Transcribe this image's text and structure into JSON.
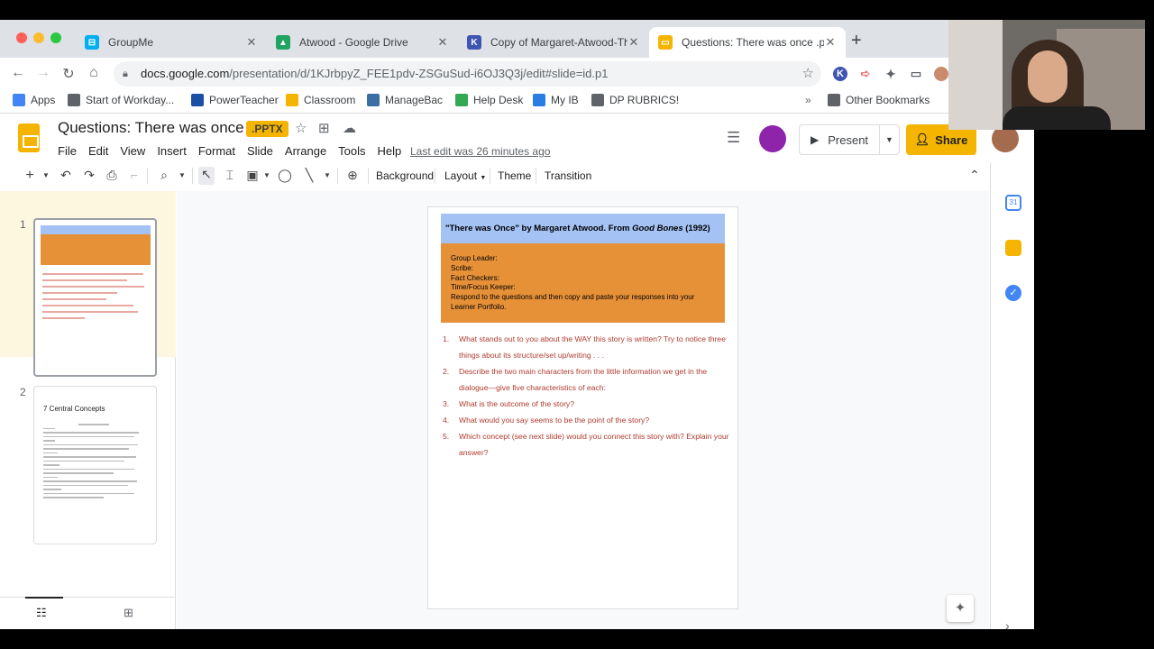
{
  "browser": {
    "tabs": [
      {
        "title": "GroupMe",
        "icon": "groupme-icon",
        "color": "#00aff0",
        "glyph": "⊟"
      },
      {
        "title": "Atwood - Google Drive",
        "icon": "google-drive-icon",
        "color": "#1fa463",
        "glyph": "▲"
      },
      {
        "title": "Copy of Margaret-Atwood-The",
        "icon": "k-icon",
        "color": "#4054b2",
        "glyph": "K"
      },
      {
        "title": "Questions: There was once .pp",
        "icon": "slides-icon",
        "color": "#f4b400",
        "glyph": "▭"
      }
    ],
    "new_tab": "+",
    "close": "✕",
    "url_host": "docs.google.com",
    "url_path": "/presentation/d/1KJrbpyZ_FEE1pdv-ZSGuSud-i6OJ3Q3j/edit#slide=id.p1"
  },
  "bookmarks": {
    "items": [
      {
        "label": "Apps",
        "color": "#4285f4"
      },
      {
        "label": "Start of Workday...",
        "color": "#5f6368"
      },
      {
        "label": "PowerTeacher",
        "color": "#1a4fa3"
      },
      {
        "label": "Classroom",
        "color": "#f4b400"
      },
      {
        "label": "ManageBac",
        "color": "#3a6ea5"
      },
      {
        "label": "Help Desk",
        "color": "#34a853"
      },
      {
        "label": "My IB",
        "color": "#2a7de1"
      },
      {
        "label": "DP RUBRICS!",
        "color": "#5f6368"
      }
    ],
    "more": "»",
    "other": "Other Bookmarks"
  },
  "doc": {
    "title": "Questions: There was once",
    "badge": ".PPTX",
    "menu": [
      "File",
      "Edit",
      "View",
      "Insert",
      "Format",
      "Slide",
      "Arrange",
      "Tools",
      "Help"
    ],
    "last_edit": "Last edit was 26 minutes ago",
    "present_label": "Present",
    "share_label": "Share"
  },
  "toolbar": {
    "background": "Background",
    "layout": "Layout",
    "theme": "Theme",
    "transition": "Transition"
  },
  "filmstrip": {
    "slides": [
      {
        "number": "1",
        "thumb_title": "\"There was Once\" by Margaret Atwood. From Good Bones (1992)"
      },
      {
        "number": "2",
        "thumb_title": "7 Central Concepts"
      }
    ]
  },
  "slide": {
    "title_pre": "\"There was Once\" by Margaret Atwood. From ",
    "title_italic": "Good Bones",
    "title_post": " (1992)",
    "roles": [
      "Group Leader:",
      "Scribe:",
      "Fact Checkers:",
      "Time/Focus Keeper:",
      "Respond to the questions and then copy and paste your responses  into your Learner Portfolio."
    ],
    "questions": [
      {
        "n": "1.",
        "text": "What stands out to you about the WAY this story is written? Try to notice three things about its structure/set up/writing . . ."
      },
      {
        "n": "2.",
        "text": "Describe the two main characters from the little information we get in the dialogue—give five characteristics of each:"
      },
      {
        "n": "3.",
        "text": " What is the outcome of the story?"
      },
      {
        "n": "4.",
        "text": "What would you say seems to be the point of the story?"
      },
      {
        "n": "5.",
        "text": "Which concept (see next slide) would you connect this story with? Explain your answer?"
      }
    ]
  },
  "colors": {
    "accent": "#f4b400",
    "title_band": "#a4c2f4",
    "role_band": "#e69138",
    "question_text": "#b03a2e"
  }
}
